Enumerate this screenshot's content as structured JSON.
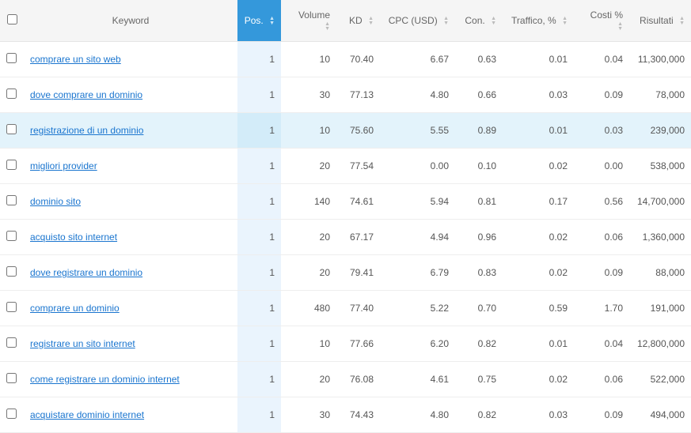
{
  "columns": {
    "keyword": "Keyword",
    "pos": "Pos.",
    "volume": "Volume",
    "kd": "KD",
    "cpc": "CPC (USD)",
    "con": "Con.",
    "traffic": "Traffico, %",
    "cost": "Costi %",
    "results": "Risultati"
  },
  "rows": [
    {
      "keyword": "comprare un sito web",
      "pos": "1",
      "volume": "10",
      "kd": "70.40",
      "cpc": "6.67",
      "con": "0.63",
      "traffic": "0.01",
      "cost": "0.04",
      "results": "11,300,000",
      "highlighted": false
    },
    {
      "keyword": "dove comprare un dominio",
      "pos": "1",
      "volume": "30",
      "kd": "77.13",
      "cpc": "4.80",
      "con": "0.66",
      "traffic": "0.03",
      "cost": "0.09",
      "results": "78,000",
      "highlighted": false
    },
    {
      "keyword": "registrazione di un dominio",
      "pos": "1",
      "volume": "10",
      "kd": "75.60",
      "cpc": "5.55",
      "con": "0.89",
      "traffic": "0.01",
      "cost": "0.03",
      "results": "239,000",
      "highlighted": true
    },
    {
      "keyword": "migliori provider",
      "pos": "1",
      "volume": "20",
      "kd": "77.54",
      "cpc": "0.00",
      "con": "0.10",
      "traffic": "0.02",
      "cost": "0.00",
      "results": "538,000",
      "highlighted": false
    },
    {
      "keyword": "dominio sito",
      "pos": "1",
      "volume": "140",
      "kd": "74.61",
      "cpc": "5.94",
      "con": "0.81",
      "traffic": "0.17",
      "cost": "0.56",
      "results": "14,700,000",
      "highlighted": false
    },
    {
      "keyword": "acquisto sito internet",
      "pos": "1",
      "volume": "20",
      "kd": "67.17",
      "cpc": "4.94",
      "con": "0.96",
      "traffic": "0.02",
      "cost": "0.06",
      "results": "1,360,000",
      "highlighted": false
    },
    {
      "keyword": "dove registrare un dominio",
      "pos": "1",
      "volume": "20",
      "kd": "79.41",
      "cpc": "6.79",
      "con": "0.83",
      "traffic": "0.02",
      "cost": "0.09",
      "results": "88,000",
      "highlighted": false
    },
    {
      "keyword": "comprare un dominio",
      "pos": "1",
      "volume": "480",
      "kd": "77.40",
      "cpc": "5.22",
      "con": "0.70",
      "traffic": "0.59",
      "cost": "1.70",
      "results": "191,000",
      "highlighted": false
    },
    {
      "keyword": "registrare un sito internet",
      "pos": "1",
      "volume": "10",
      "kd": "77.66",
      "cpc": "6.20",
      "con": "0.82",
      "traffic": "0.01",
      "cost": "0.04",
      "results": "12,800,000",
      "highlighted": false
    },
    {
      "keyword": "come registrare un dominio internet",
      "pos": "1",
      "volume": "20",
      "kd": "76.08",
      "cpc": "4.61",
      "con": "0.75",
      "traffic": "0.02",
      "cost": "0.06",
      "results": "522,000",
      "highlighted": false
    },
    {
      "keyword": "acquistare dominio internet",
      "pos": "1",
      "volume": "30",
      "kd": "74.43",
      "cpc": "4.80",
      "con": "0.82",
      "traffic": "0.03",
      "cost": "0.09",
      "results": "494,000",
      "highlighted": false
    }
  ]
}
